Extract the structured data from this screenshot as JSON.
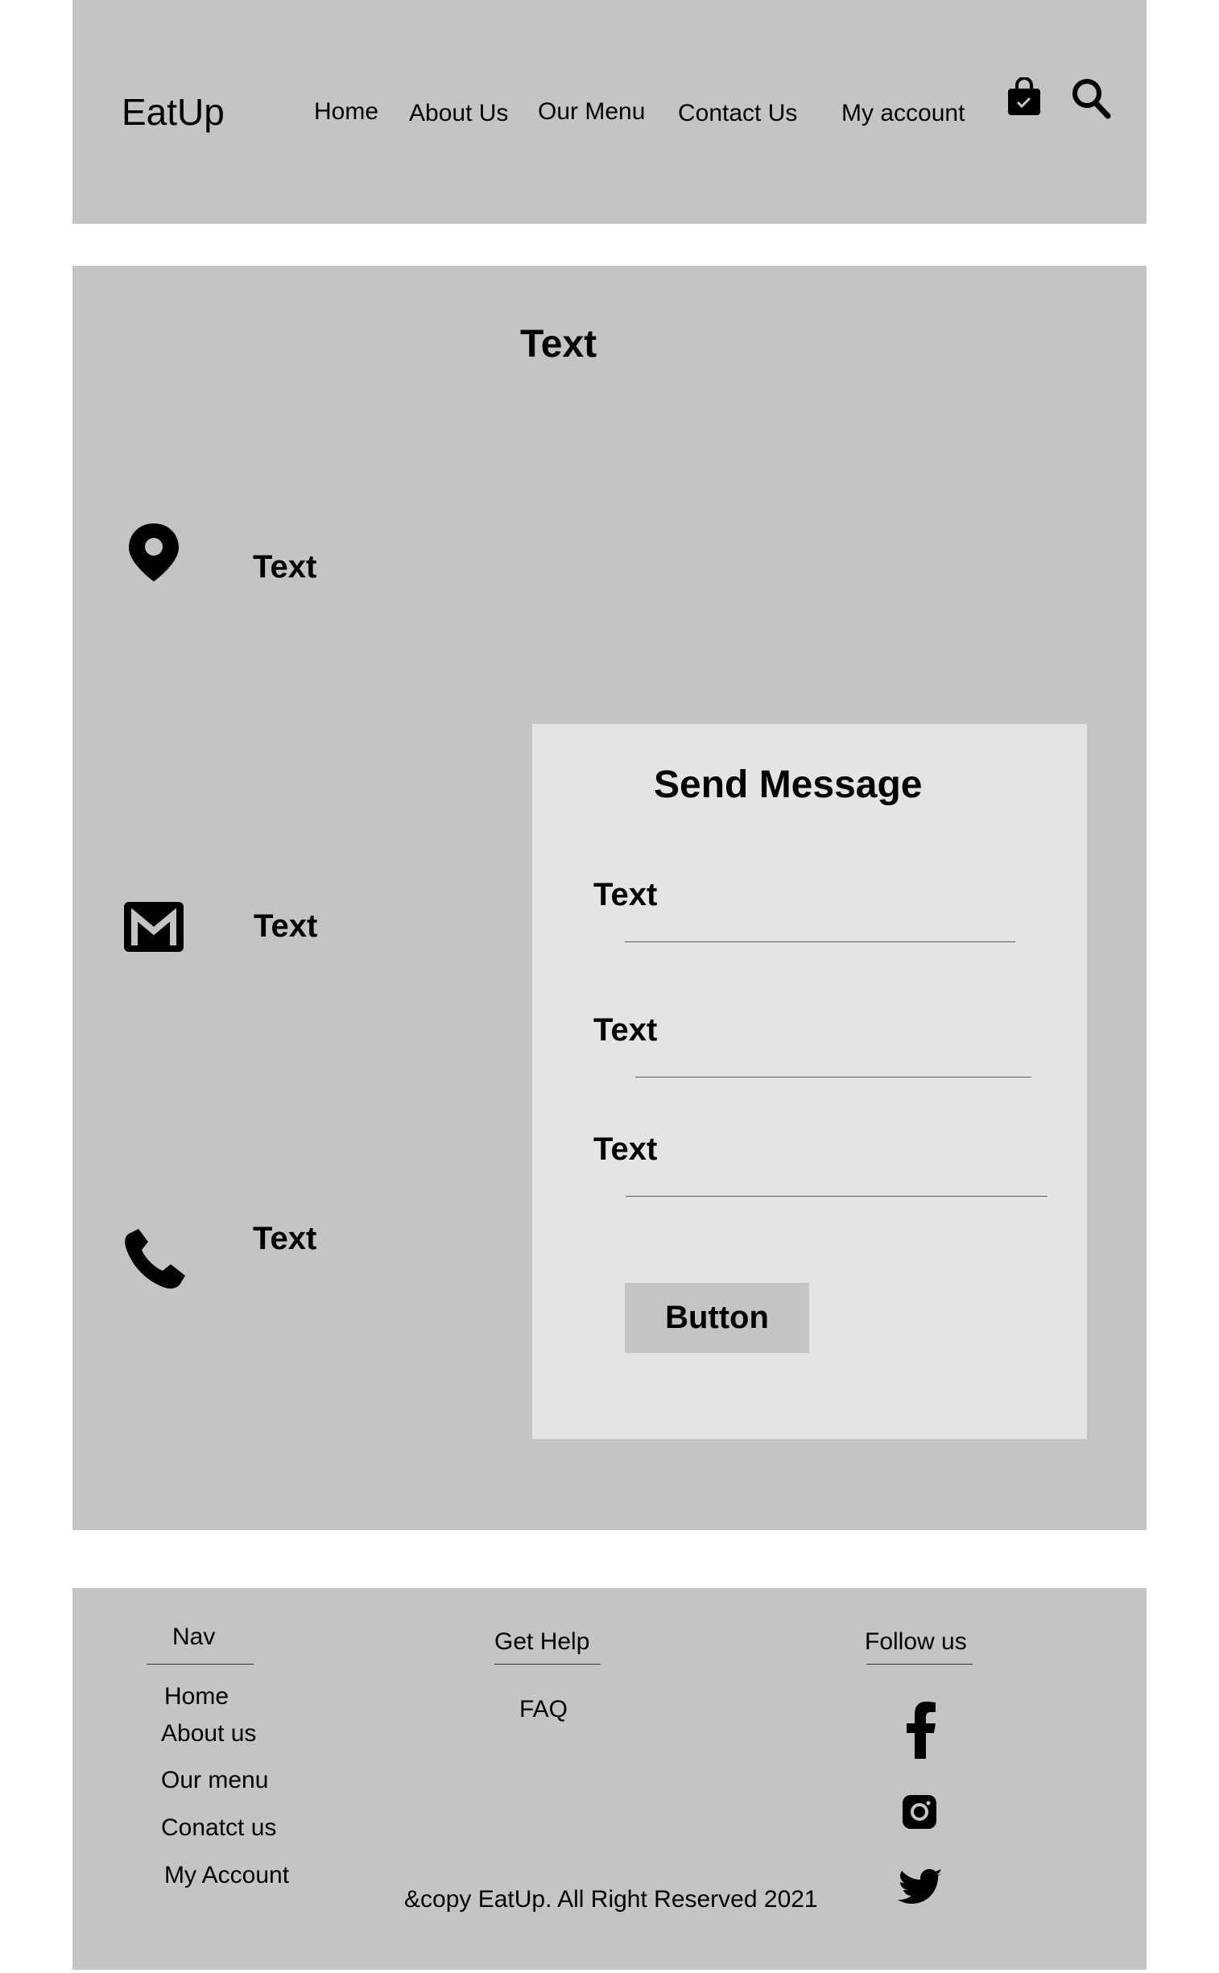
{
  "header": {
    "logo": "EatUp",
    "nav": [
      "Home",
      "About Us",
      "Our Menu",
      "Contact Us",
      "My account"
    ],
    "icons": [
      "shopping-bag-icon",
      "search-icon"
    ]
  },
  "contact": {
    "title": "Text",
    "info": [
      {
        "icon": "map-pin-icon",
        "text": "Text"
      },
      {
        "icon": "mail-icon",
        "text": "Text"
      },
      {
        "icon": "phone-icon",
        "text": "Text"
      }
    ],
    "form": {
      "title": "Send Message",
      "fields": [
        "Text",
        "Text",
        "Text"
      ],
      "button": "Button"
    }
  },
  "footer": {
    "nav": {
      "heading": "Nav",
      "links": [
        "Home",
        "About us",
        "Our menu",
        "Conatct us",
        "My Account"
      ]
    },
    "help": {
      "heading": "Get Help",
      "links": [
        "FAQ"
      ]
    },
    "follow": {
      "heading": "Follow us",
      "icons": [
        "facebook-icon",
        "instagram-icon",
        "twitter-icon"
      ]
    },
    "copyright": "&copy EatUp. All Right Reserved 2021"
  },
  "colors": {
    "panel": "#c4c4c4",
    "card": "#e4e4e4",
    "text": "#000000",
    "background": "#ffffff"
  }
}
